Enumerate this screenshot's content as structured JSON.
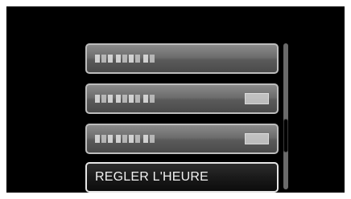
{
  "menu": {
    "items": [
      {
        "label": "",
        "placeholder_pixelated": true,
        "has_value": false
      },
      {
        "label": "",
        "placeholder_pixelated": true,
        "has_value": true
      },
      {
        "label": "",
        "placeholder_pixelated": true,
        "has_value": true
      },
      {
        "label": "REGLER L'HEURE",
        "placeholder_pixelated": false,
        "has_value": false,
        "selected": true
      }
    ]
  },
  "colors": {
    "background": "#000000",
    "item_border": "#bdbdbd",
    "selected_border": "#e6e6e6",
    "text": "#f2f2f2"
  }
}
